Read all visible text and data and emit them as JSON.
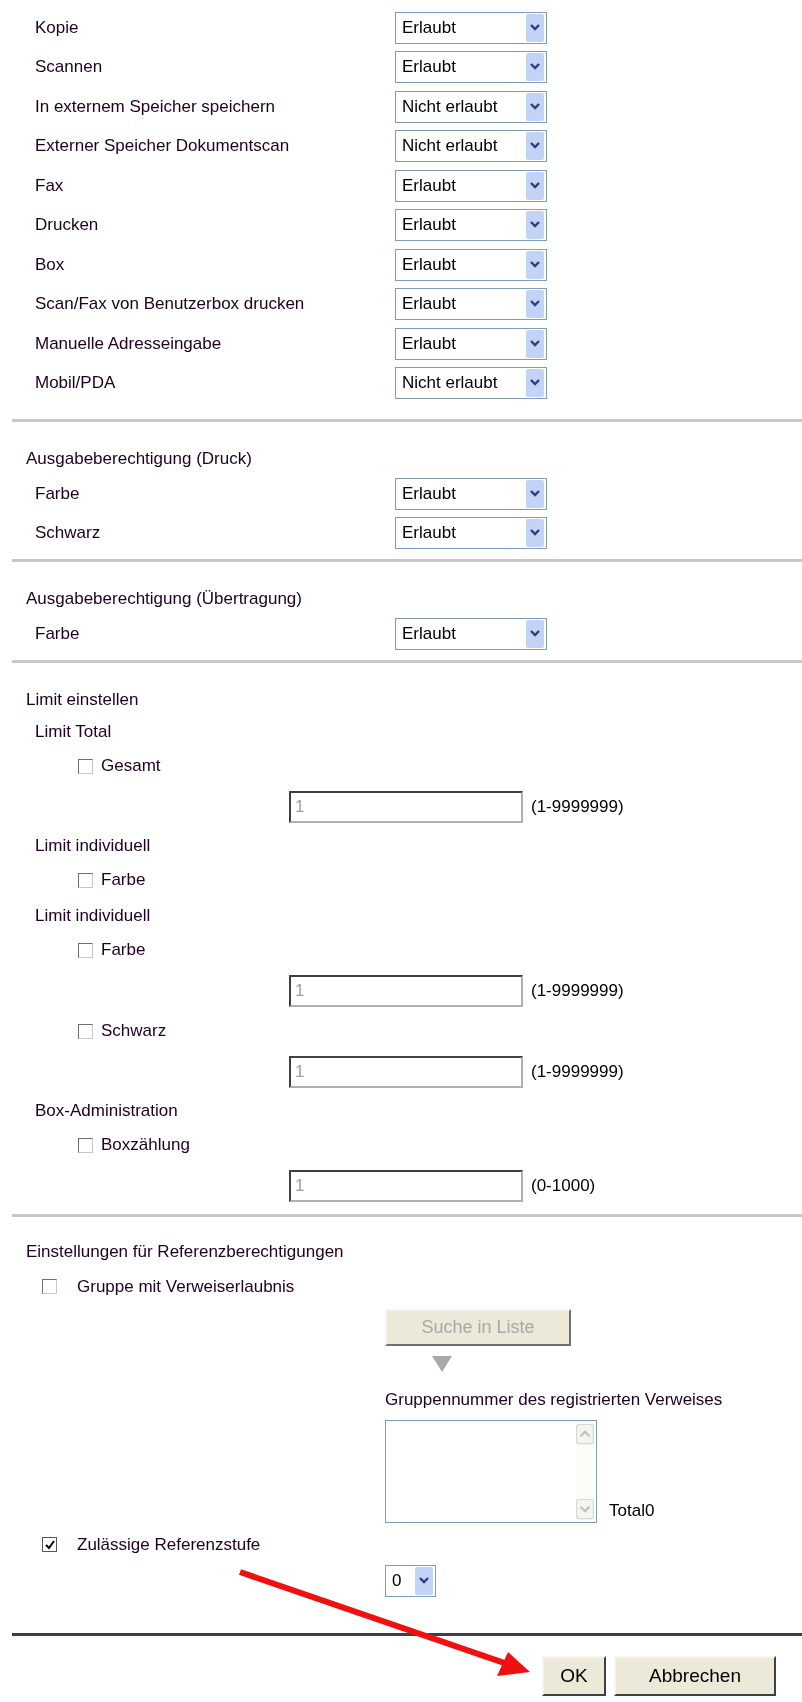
{
  "permissions": [
    {
      "label": "Kopie",
      "value": "Erlaubt"
    },
    {
      "label": "Scannen",
      "value": "Erlaubt"
    },
    {
      "label": "In externem Speicher speichern",
      "value": "Nicht erlaubt"
    },
    {
      "label": "Externer Speicher Dokumentscan",
      "value": "Nicht erlaubt"
    },
    {
      "label": "Fax",
      "value": "Erlaubt"
    },
    {
      "label": "Drucken",
      "value": "Erlaubt"
    },
    {
      "label": "Box",
      "value": "Erlaubt"
    },
    {
      "label": "Scan/Fax von Benutzerbox drucken",
      "value": "Erlaubt"
    },
    {
      "label": "Manuelle Adresseingabe",
      "value": "Erlaubt"
    },
    {
      "label": "Mobil/PDA",
      "value": "Nicht erlaubt"
    }
  ],
  "output_sections": [
    {
      "title": "Ausgabeberechtigung (Druck)",
      "rows": [
        {
          "label": "Farbe",
          "value": "Erlaubt"
        },
        {
          "label": "Schwarz",
          "value": "Erlaubt"
        }
      ]
    },
    {
      "title": "Ausgabeberechtigung (Übertragung)",
      "rows": [
        {
          "label": "Farbe",
          "value": "Erlaubt"
        }
      ]
    }
  ],
  "limits": {
    "title": "Limit einstellen",
    "groups": [
      {
        "title": "Limit Total",
        "items": [
          {
            "kind": "checkbox",
            "label": "Gesamt",
            "checked": false
          },
          {
            "kind": "field",
            "value": "1",
            "disabled": true,
            "range": "(1-9999999)"
          }
        ]
      },
      {
        "title": "Limit individuell",
        "items": [
          {
            "kind": "checkbox",
            "label": "Farbe",
            "checked": false
          }
        ]
      },
      {
        "title": "Limit individuell",
        "items": [
          {
            "kind": "checkbox",
            "label": "Farbe",
            "checked": false
          },
          {
            "kind": "field",
            "value": "1",
            "disabled": true,
            "range": "(1-9999999)"
          },
          {
            "kind": "checkbox",
            "label": "Schwarz",
            "checked": false
          },
          {
            "kind": "field",
            "value": "1",
            "disabled": true,
            "range": "(1-9999999)"
          }
        ]
      },
      {
        "title": "Box-Administration",
        "items": [
          {
            "kind": "checkbox",
            "label": "Boxzählung",
            "checked": false
          },
          {
            "kind": "field",
            "value": "1",
            "disabled": true,
            "range": "(0-1000)"
          }
        ]
      }
    ]
  },
  "reference": {
    "title": "Einstellungen für Referenzberechtigungen",
    "group_checkbox": {
      "label": "Gruppe mit Verweiserlaubnis",
      "checked": false
    },
    "search_button": {
      "label": "Suche in Liste",
      "disabled": true
    },
    "list_label": "Gruppennummer des registrierten Verweises",
    "total": "Total0",
    "level_checkbox": {
      "label": "Zulässige Referenzstufe",
      "checked": true
    },
    "level_select": {
      "value": "0"
    }
  },
  "buttons": [
    "OK",
    "Abbrechen"
  ]
}
